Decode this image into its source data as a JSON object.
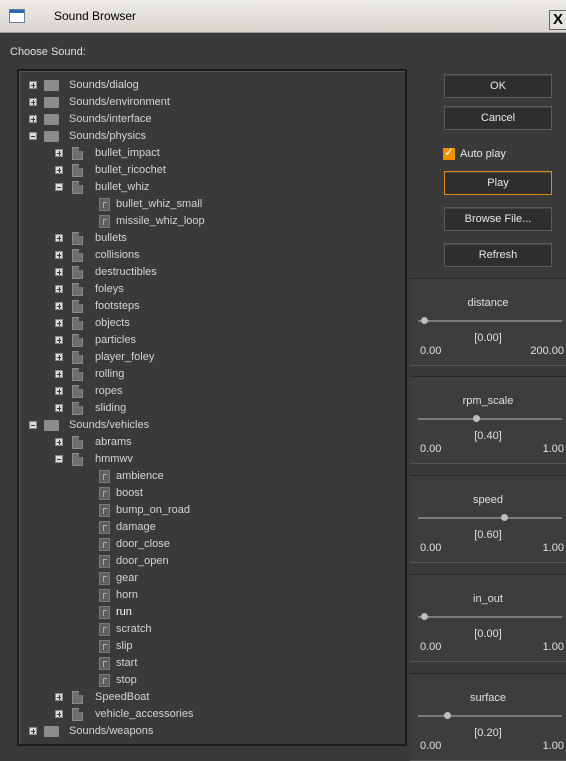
{
  "window": {
    "title": "Sound Browser",
    "close_glyph": "X"
  },
  "tree_header": "Choose Sound:",
  "tree": [
    {
      "depth": 0,
      "icon": "folder",
      "expander": "plus",
      "label": "Sounds/dialog"
    },
    {
      "depth": 0,
      "icon": "folder",
      "expander": "plus",
      "label": "Sounds/environment"
    },
    {
      "depth": 0,
      "icon": "folder",
      "expander": "plus",
      "label": "Sounds/interface"
    },
    {
      "depth": 0,
      "icon": "folder",
      "expander": "minus",
      "label": "Sounds/physics"
    },
    {
      "depth": 1,
      "icon": "file",
      "expander": "plus",
      "label": "bullet_impact"
    },
    {
      "depth": 1,
      "icon": "file",
      "expander": "plus",
      "label": "bullet_ricochet"
    },
    {
      "depth": 1,
      "icon": "file",
      "expander": "minus",
      "label": "bullet_whiz"
    },
    {
      "depth": 2,
      "icon": "sound",
      "expander": "none",
      "label": "bullet_whiz_small"
    },
    {
      "depth": 2,
      "icon": "sound",
      "expander": "none",
      "label": "missile_whiz_loop"
    },
    {
      "depth": 1,
      "icon": "file",
      "expander": "plus",
      "label": "bullets"
    },
    {
      "depth": 1,
      "icon": "file",
      "expander": "plus",
      "label": "collisions"
    },
    {
      "depth": 1,
      "icon": "file",
      "expander": "plus",
      "label": "destructibles"
    },
    {
      "depth": 1,
      "icon": "file",
      "expander": "plus",
      "label": "foleys"
    },
    {
      "depth": 1,
      "icon": "file",
      "expander": "plus",
      "label": "footsteps"
    },
    {
      "depth": 1,
      "icon": "file",
      "expander": "plus",
      "label": "objects"
    },
    {
      "depth": 1,
      "icon": "file",
      "expander": "plus",
      "label": "particles"
    },
    {
      "depth": 1,
      "icon": "file",
      "expander": "plus",
      "label": "player_foley"
    },
    {
      "depth": 1,
      "icon": "file",
      "expander": "plus",
      "label": "rolling"
    },
    {
      "depth": 1,
      "icon": "file",
      "expander": "plus",
      "label": "ropes"
    },
    {
      "depth": 1,
      "icon": "file",
      "expander": "plus",
      "label": "sliding"
    },
    {
      "depth": 0,
      "icon": "folder",
      "expander": "minus",
      "label": "Sounds/vehicles"
    },
    {
      "depth": 1,
      "icon": "file",
      "expander": "plus",
      "label": "abrams"
    },
    {
      "depth": 1,
      "icon": "file",
      "expander": "minus",
      "label": "hmmwv"
    },
    {
      "depth": 2,
      "icon": "sound",
      "expander": "none",
      "label": "ambience"
    },
    {
      "depth": 2,
      "icon": "sound",
      "expander": "none",
      "label": "boost"
    },
    {
      "depth": 2,
      "icon": "sound",
      "expander": "none",
      "label": "bump_on_road"
    },
    {
      "depth": 2,
      "icon": "sound",
      "expander": "none",
      "label": "damage"
    },
    {
      "depth": 2,
      "icon": "sound",
      "expander": "none",
      "label": "door_close"
    },
    {
      "depth": 2,
      "icon": "sound",
      "expander": "none",
      "label": "door_open"
    },
    {
      "depth": 2,
      "icon": "sound",
      "expander": "none",
      "label": "gear"
    },
    {
      "depth": 2,
      "icon": "sound",
      "expander": "none",
      "label": "horn"
    },
    {
      "depth": 2,
      "icon": "sound",
      "expander": "none",
      "label": "run",
      "selected": true
    },
    {
      "depth": 2,
      "icon": "sound",
      "expander": "none",
      "label": "scratch"
    },
    {
      "depth": 2,
      "icon": "sound",
      "expander": "none",
      "label": "slip"
    },
    {
      "depth": 2,
      "icon": "sound",
      "expander": "none",
      "label": "start"
    },
    {
      "depth": 2,
      "icon": "sound",
      "expander": "none",
      "label": "stop"
    },
    {
      "depth": 1,
      "icon": "file",
      "expander": "plus",
      "label": "SpeedBoat"
    },
    {
      "depth": 1,
      "icon": "file",
      "expander": "plus",
      "label": "vehicle_accessories"
    },
    {
      "depth": 0,
      "icon": "folder",
      "expander": "plus",
      "label": "Sounds/weapons"
    }
  ],
  "buttons": {
    "ok": "OK",
    "cancel": "Cancel",
    "auto_play": "Auto play",
    "auto_play_checked": true,
    "play": "Play",
    "browse": "Browse File...",
    "refresh": "Refresh"
  },
  "sliders": [
    {
      "name": "distance",
      "value": "[0.00]",
      "min": "0.00",
      "max": "200.00",
      "fraction": 0.0
    },
    {
      "name": "rpm_scale",
      "value": "[0.40]",
      "min": "0.00",
      "max": "1.00",
      "fraction": 0.4
    },
    {
      "name": "speed",
      "value": "[0.60]",
      "min": "0.00",
      "max": "1.00",
      "fraction": 0.6
    },
    {
      "name": "in_out",
      "value": "[0.00]",
      "min": "0.00",
      "max": "1.00",
      "fraction": 0.0
    },
    {
      "name": "surface",
      "value": "[0.20]",
      "min": "0.00",
      "max": "1.00",
      "fraction": 0.2
    }
  ],
  "colors": {
    "accent": "#f29100",
    "panel": "#3a3a3a",
    "text": "#d8d8d8"
  }
}
